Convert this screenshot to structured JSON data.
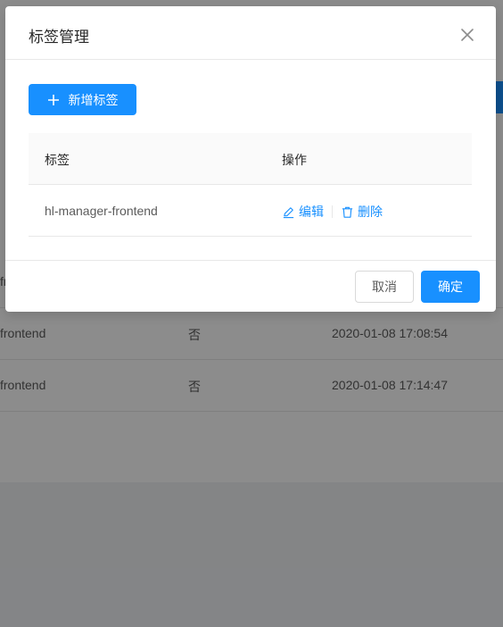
{
  "background": {
    "rows": [
      {
        "tag": "fr",
        "flag": "",
        "time": ""
      },
      {
        "tag": "frontend",
        "flag": "否",
        "time": "2020-01-08 17:08:54"
      },
      {
        "tag": "frontend",
        "flag": "否",
        "time": "2020-01-08 17:14:47"
      }
    ]
  },
  "modal": {
    "title": "标签管理",
    "add_button_label": "新增标签",
    "table": {
      "columns": [
        "标签",
        "操作"
      ],
      "rows": [
        {
          "tag": "hl-manager-frontend",
          "edit_label": "编辑",
          "delete_label": "删除"
        }
      ]
    },
    "footer": {
      "cancel_label": "取消",
      "ok_label": "确定"
    }
  },
  "icons": {
    "close": "close-icon",
    "add": "plus-icon",
    "edit": "edit-icon",
    "delete": "delete-icon"
  },
  "colors": {
    "primary": "#1890ff",
    "mask": "rgba(0,0,0,0.45)"
  }
}
